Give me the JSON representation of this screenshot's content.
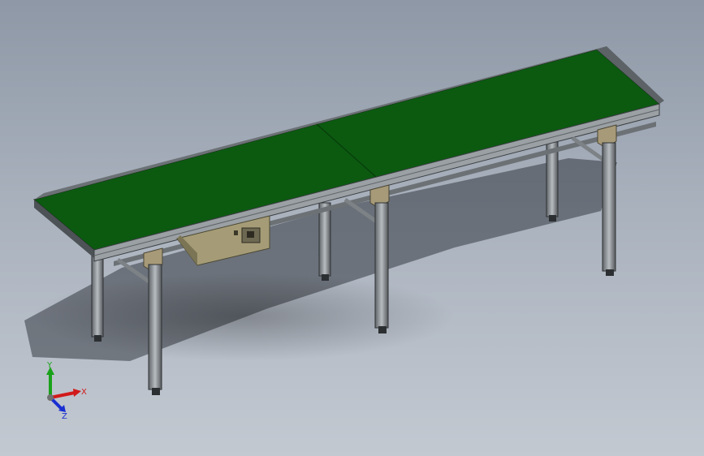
{
  "viewport": {
    "background_top": "#8e98a6",
    "background_bottom": "#c3c9d1"
  },
  "model": {
    "belt_color": "#0b5a10",
    "frame_color": "#8a8f93",
    "motor_box_color": "#9d9470",
    "bracket_color": "#a79a78"
  },
  "triad": {
    "x_label": "X",
    "y_label": "Y",
    "z_label": "Z",
    "x_color": "#d11a1a",
    "y_color": "#1aa11a",
    "z_color": "#1a2fd1"
  }
}
